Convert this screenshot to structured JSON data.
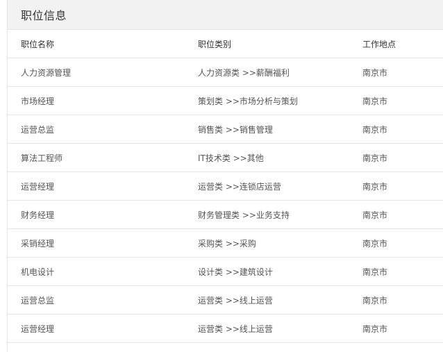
{
  "panel": {
    "title": "职位信息"
  },
  "table": {
    "headers": {
      "title": "职位名称",
      "category": "职位类别",
      "location": "工作地点"
    },
    "rows": [
      {
        "title": "人力资源管理",
        "category": "人力资源类 >>薪酬福利",
        "location": "南京市"
      },
      {
        "title": "市场经理",
        "category": "策划类 >>市场分析与策划",
        "location": "南京市"
      },
      {
        "title": "运营总监",
        "category": "销售类 >>销售管理",
        "location": "南京市"
      },
      {
        "title": "算法工程师",
        "category": "IT技术类 >>其他",
        "location": "南京市"
      },
      {
        "title": "运营经理",
        "category": "运营类 >>连锁店运营",
        "location": "南京市"
      },
      {
        "title": "财务经理",
        "category": "财务管理类 >>业务支持",
        "location": "南京市"
      },
      {
        "title": "采销经理",
        "category": "采购类 >>采购",
        "location": "南京市"
      },
      {
        "title": "机电设计",
        "category": "设计类 >>建筑设计",
        "location": "南京市"
      },
      {
        "title": "运营总监",
        "category": "运营类 >>线上运营",
        "location": "南京市"
      },
      {
        "title": "运营经理",
        "category": "运营类 >>线上运营",
        "location": "南京市"
      }
    ]
  }
}
